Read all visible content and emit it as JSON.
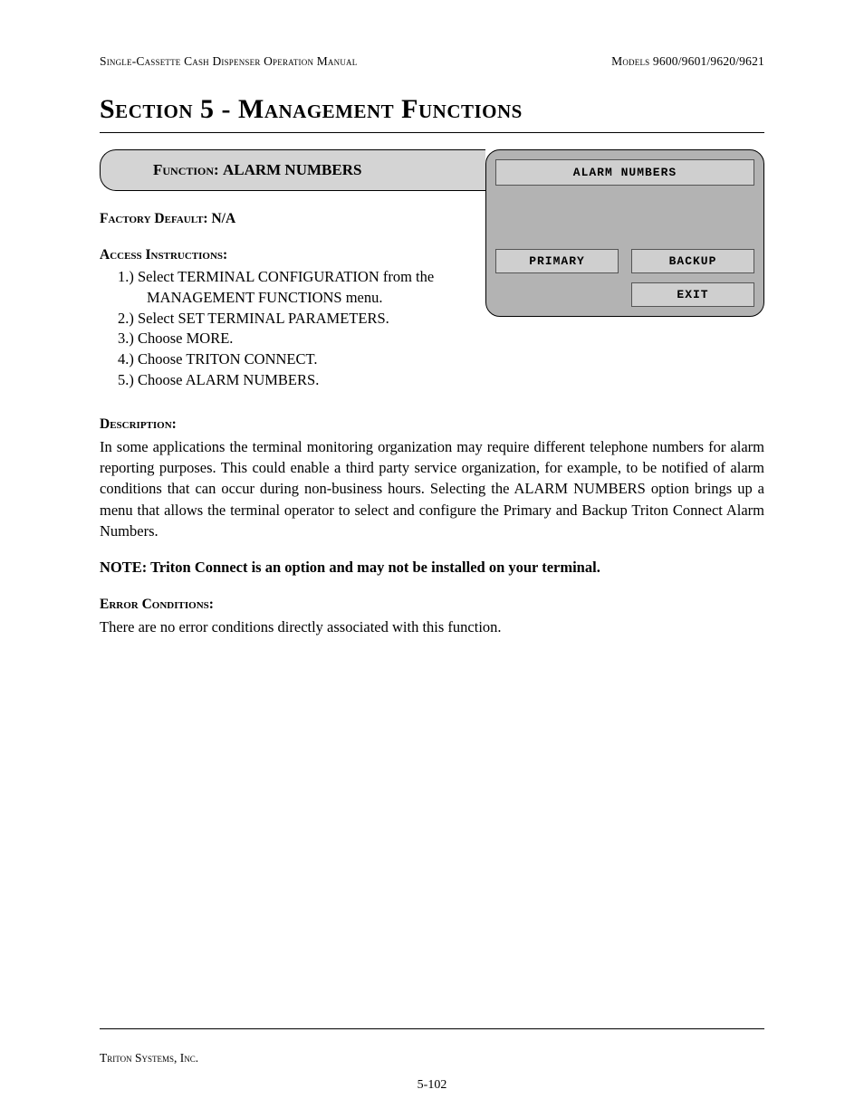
{
  "header": {
    "left": "Single-Cassette Cash Dispenser Operation Manual",
    "right": "Models 9600/9601/9620/9621"
  },
  "section_title": "Section 5 - Management Functions",
  "function_box": {
    "label": "Function:",
    "name": "ALARM NUMBERS"
  },
  "factory_default": {
    "label": "Factory Default:",
    "value": "N/A"
  },
  "access_instructions_label": "Access Instructions:",
  "instructions": [
    "Select TERMINAL CONFIGURATION from the MANAGEMENT FUNCTIONS menu.",
    "Select SET TERMINAL PARAMETERS.",
    "Choose MORE.",
    "Choose TRITON CONNECT.",
    "Choose ALARM NUMBERS."
  ],
  "description_label": "Description:",
  "description_text": "In some applications the terminal monitoring organization may require different telephone numbers for alarm reporting purposes. This could enable a third party service organization, for example, to be notified of alarm conditions that can occur during non-business hours. Selecting the ALARM NUMBERS option brings up a menu that allows the terminal operator to select and configure the Primary and Backup Triton Connect Alarm Numbers.",
  "note_text": "NOTE: Triton Connect is an option and may not be installed on your terminal.",
  "error_conditions_label": "Error Conditions:",
  "error_conditions_text": "There are no error conditions directly associated with this function.",
  "screen": {
    "title": "ALARM NUMBERS",
    "buttons": {
      "primary": "PRIMARY",
      "backup": "BACKUP",
      "exit": "EXIT"
    }
  },
  "footer": {
    "company": "Triton Systems, Inc.",
    "page_number": "5-102"
  }
}
